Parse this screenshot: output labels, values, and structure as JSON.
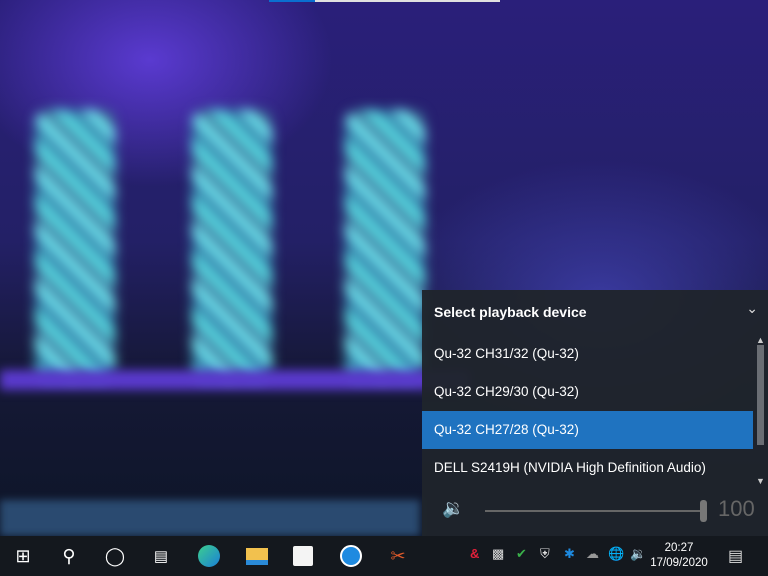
{
  "progress": {
    "percent": 20
  },
  "flyout": {
    "title": "Select playback device",
    "devices": [
      "Qu-32 CH31/32 (Qu-32)",
      "Qu-32 CH29/30 (Qu-32)",
      "Qu-32 CH27/28 (Qu-32)",
      "DELL S2419H (NVIDIA High Definition Audio)"
    ],
    "selected_index": 2,
    "volume": "100"
  },
  "taskbar": {
    "time": "20:27",
    "date": "17/09/2020"
  }
}
